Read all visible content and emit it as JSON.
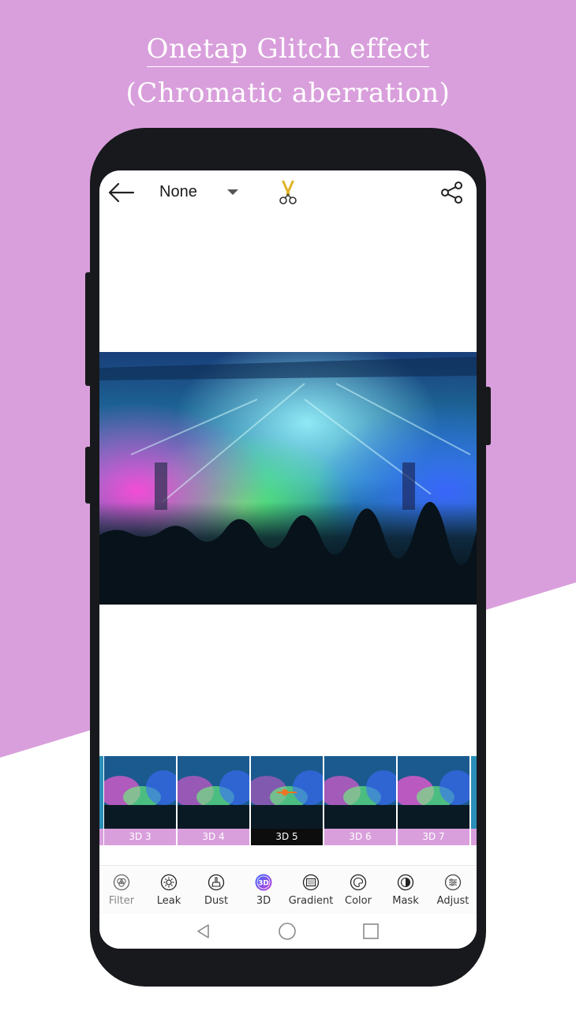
{
  "headline": {
    "line1": "Onetap Glitch effect",
    "line2": "(Chromatic aberration)"
  },
  "colors": {
    "background_pink": "#d99fdc",
    "phone_body": "#18191c",
    "accent_active": "#0d0d0d"
  },
  "topbar": {
    "back_icon": "arrow-left-icon",
    "selector_value": "None",
    "cut_icon": "scissors-icon",
    "share_icon": "share-icon"
  },
  "effects": [
    {
      "label": "3D 3"
    },
    {
      "label": "3D 4"
    },
    {
      "label": "3D 5",
      "active": true
    },
    {
      "label": "3D 6"
    },
    {
      "label": "3D 7"
    }
  ],
  "tabs": [
    {
      "label": "Filter",
      "icon": "filter-icon"
    },
    {
      "label": "Leak",
      "icon": "sun-icon"
    },
    {
      "label": "Dust",
      "icon": "brush-icon"
    },
    {
      "label": "3D",
      "icon": "3d-badge-icon",
      "active": true
    },
    {
      "label": "Gradient",
      "icon": "gradient-icon"
    },
    {
      "label": "Color",
      "icon": "palette-icon"
    },
    {
      "label": "Mask",
      "icon": "mask-icon"
    },
    {
      "label": "Adjust",
      "icon": "sliders-icon"
    }
  ],
  "navbar": {
    "back": "nav-back-icon",
    "home": "nav-home-icon",
    "recents": "nav-recents-icon"
  }
}
